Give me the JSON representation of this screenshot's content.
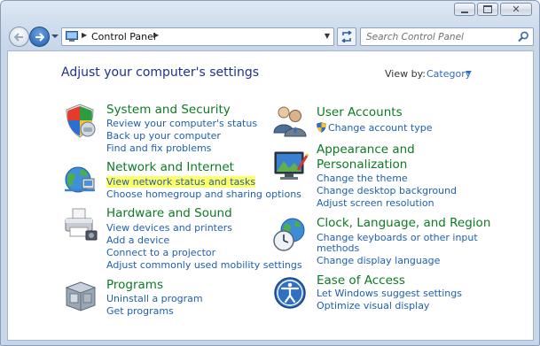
{
  "window": {
    "caption_buttons": [
      "minimize",
      "maximize",
      "close"
    ]
  },
  "address_bar": {
    "breadcrumb": "Control Panel",
    "search_placeholder": "Search Control Panel"
  },
  "header": {
    "title": "Adjust your computer's settings",
    "view_by_label": "View by:",
    "view_by_value": "Category"
  },
  "categories": {
    "system": {
      "title": "System and Security",
      "icon": "shield-icon",
      "links": [
        "Review your computer's status",
        "Back up your computer",
        "Find and fix problems"
      ]
    },
    "network": {
      "title": "Network and Internet",
      "icon": "network-globe-icon",
      "links": [
        "View network status and tasks",
        "Choose homegroup and sharing options"
      ],
      "highlighted_link": "View network status and tasks"
    },
    "hardware": {
      "title": "Hardware and Sound",
      "icon": "printer-icon",
      "links": [
        "View devices and printers",
        "Add a device",
        "Connect to a projector",
        "Adjust commonly used mobility settings"
      ]
    },
    "programs": {
      "title": "Programs",
      "icon": "programs-box-icon",
      "links": [
        "Uninstall a program",
        "Get programs"
      ]
    },
    "users": {
      "title": "User Accounts",
      "icon": "users-icon",
      "links": [
        "Change account type"
      ]
    },
    "appearance": {
      "title_line1": "Appearance and",
      "title_line2": "Personalization",
      "icon": "appearance-monitor-icon",
      "links": [
        "Change the theme",
        "Change desktop background",
        "Adjust screen resolution"
      ]
    },
    "clock": {
      "title": "Clock, Language, and Region",
      "icon": "clock-globe-icon",
      "links": [
        "Change keyboards or other input",
        "methods",
        "Change display language"
      ]
    },
    "ease": {
      "title": "Ease of Access",
      "icon": "ease-of-access-icon",
      "links": [
        "Let Windows suggest settings",
        "Optimize visual display"
      ]
    }
  },
  "colors": {
    "title_blue": "#1e3287",
    "category_green": "#0e7a23",
    "link_blue": "#1f5fb3",
    "highlight": "#ffff66"
  }
}
